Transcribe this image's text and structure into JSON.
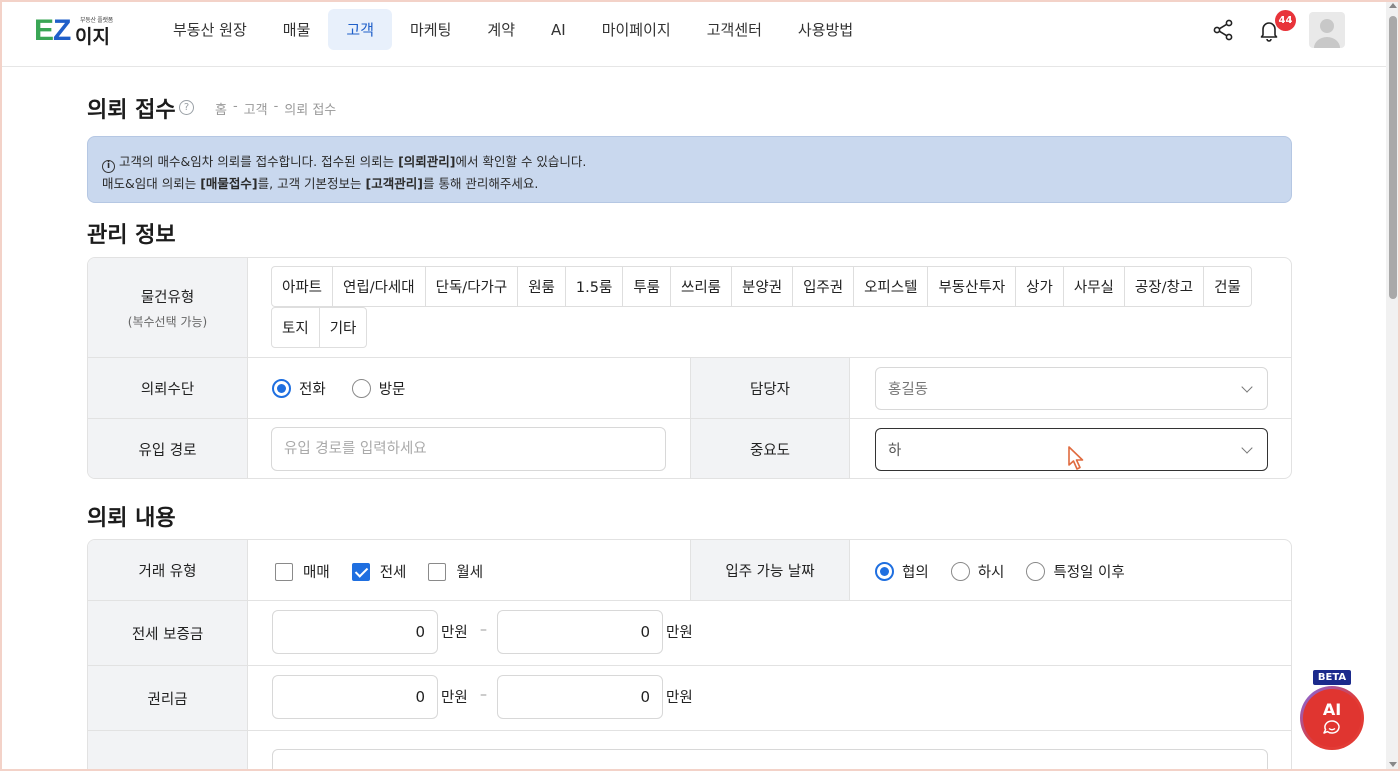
{
  "header": {
    "logo_text_ez": "EZ",
    "logo_text_iji": "이지",
    "logo_tagline": "부동산 플랫폼",
    "nav": [
      "부동산 원장",
      "매물",
      "고객",
      "마케팅",
      "계약",
      "AI",
      "마이페이지",
      "고객센터",
      "사용방법"
    ],
    "active_nav": "고객",
    "notification_count": "44"
  },
  "page": {
    "title": "의뢰 접수",
    "breadcrumb": [
      "홈",
      "-",
      "고객",
      "-",
      "의뢰 접수"
    ],
    "notice_line1_a": "고객의 매수&임차 의뢰를 접수합니다. 접수된 의뢰는 ",
    "notice_line1_b": "[의뢰관리]",
    "notice_line1_c": "에서 확인할 수 있습니다.",
    "notice_line2_a": "매도&임대 의뢰는 ",
    "notice_line2_b": "[매물접수]",
    "notice_line2_c": "를, 고객 기본정보는 ",
    "notice_line2_d": "[고객관리]",
    "notice_line2_e": "를 통해 관리해주세요."
  },
  "management": {
    "section_title": "관리 정보",
    "property_type_label": "물건유형",
    "property_type_sub": "(복수선택 가능)",
    "property_types_row1": [
      "아파트",
      "연립/다세대",
      "단독/다가구",
      "원룸",
      "1.5룸",
      "투룸",
      "쓰리룸",
      "분양권",
      "입주권",
      "오피스텔",
      "부동산투자",
      "상가",
      "사무실",
      "공장/창고",
      "건물"
    ],
    "property_types_row2": [
      "토지",
      "기타"
    ],
    "method_label": "의뢰수단",
    "method_options": [
      "전화",
      "방문"
    ],
    "method_selected": "전화",
    "manager_label": "담당자",
    "manager_value": "홍길동",
    "source_label": "유입 경로",
    "source_placeholder": "유입 경로를 입력하세요",
    "importance_label": "중요도",
    "importance_value": "하"
  },
  "request": {
    "section_title": "의뢰 내용",
    "deal_type_label": "거래 유형",
    "deal_types": [
      "매매",
      "전세",
      "월세"
    ],
    "deal_types_checked": [
      "전세"
    ],
    "move_in_label": "입주 가능 날짜",
    "move_in_options": [
      "협의",
      "하시",
      "특정일 이후"
    ],
    "move_in_selected": "협의",
    "deposit_label": "전세 보증금",
    "deposit_min": "0",
    "deposit_max": "0",
    "premium_label": "권리금",
    "premium_min": "0",
    "premium_max": "0",
    "unit": "만원",
    "range_sep": "–"
  },
  "ai_button": {
    "badge": "BETA",
    "label": "AI"
  },
  "colors": {
    "accent": "#1f6fe0",
    "brand_green": "#3aa655",
    "brand_blue": "#1f5fc9",
    "notice_bg": "#c9d8ee",
    "badge_red": "#e8343a"
  }
}
